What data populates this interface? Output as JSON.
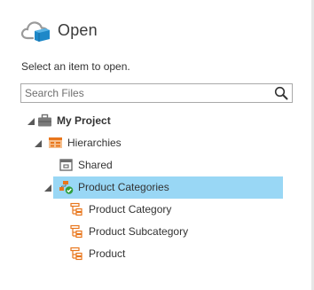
{
  "header": {
    "title": "Open",
    "logo_icon": "cloud-folder-icon"
  },
  "instructions": "Select an item to open.",
  "search": {
    "placeholder": "Search Files",
    "value": "",
    "icon": "search-icon"
  },
  "tree": {
    "project": {
      "label": "My Project",
      "expanded": true,
      "icon": "briefcase-icon"
    },
    "hierarchies": {
      "label": "Hierarchies",
      "expanded": true,
      "icon": "hierarchy-folder-icon"
    },
    "shared": {
      "label": "Shared",
      "icon": "shared-folder-icon"
    },
    "product_categories": {
      "label": "Product Categories",
      "expanded": true,
      "selected": true,
      "icon": "hierarchy-check-icon"
    },
    "levels": [
      {
        "label": "Product Category",
        "icon": "level-icon"
      },
      {
        "label": "Product Subcategory",
        "icon": "level-icon"
      },
      {
        "label": "Product",
        "icon": "level-icon"
      }
    ]
  },
  "colors": {
    "selection": "#99d7f5",
    "accent_orange": "#e8761c",
    "accent_blue": "#1e88c8",
    "check_green": "#2e9e3e"
  }
}
